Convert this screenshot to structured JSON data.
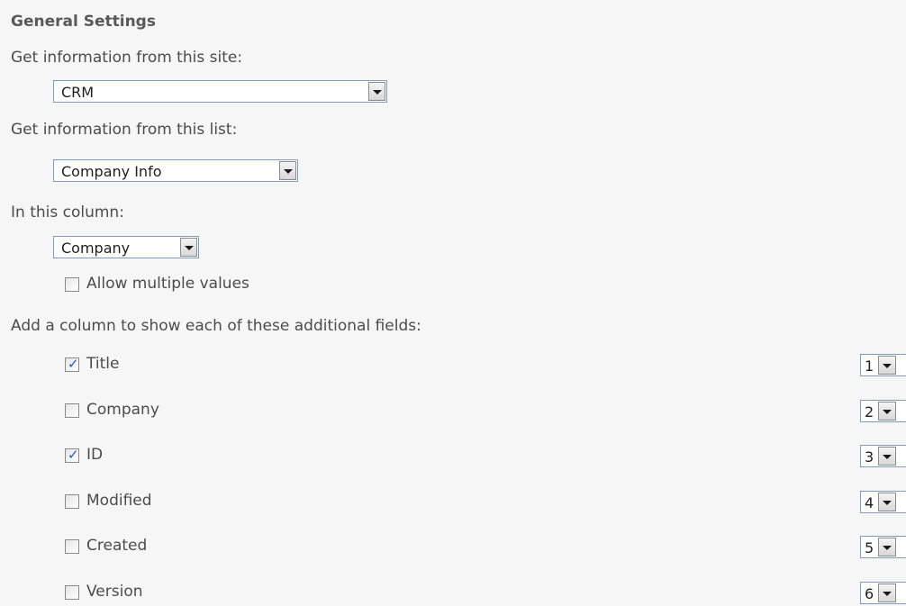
{
  "general_settings": {
    "title": "General Settings",
    "site_label": "Get information from this site:",
    "site_value": "CRM",
    "list_label": "Get information from this list:",
    "list_value": "Company Info",
    "column_label": "In this column:",
    "column_value": "Company",
    "allow_multiple_label": "Allow multiple values",
    "allow_multiple_checked": false,
    "additional_fields_label": "Add a column to show each of these additional fields:",
    "fields": [
      {
        "label": "Title",
        "checked": true,
        "order": "1"
      },
      {
        "label": "Company",
        "checked": false,
        "order": "2"
      },
      {
        "label": "ID",
        "checked": true,
        "order": "3"
      },
      {
        "label": "Modified",
        "checked": false,
        "order": "4"
      },
      {
        "label": "Created",
        "checked": false,
        "order": "5"
      },
      {
        "label": "Version",
        "checked": false,
        "order": "6"
      }
    ]
  },
  "icons": {
    "dropdown": "chevron-down-icon",
    "check": "check-icon"
  },
  "colors": {
    "background": "#f6f6f6",
    "text": "#4c4c4c",
    "input_border": "#7f9db9",
    "check_mark": "#2a57c4"
  }
}
